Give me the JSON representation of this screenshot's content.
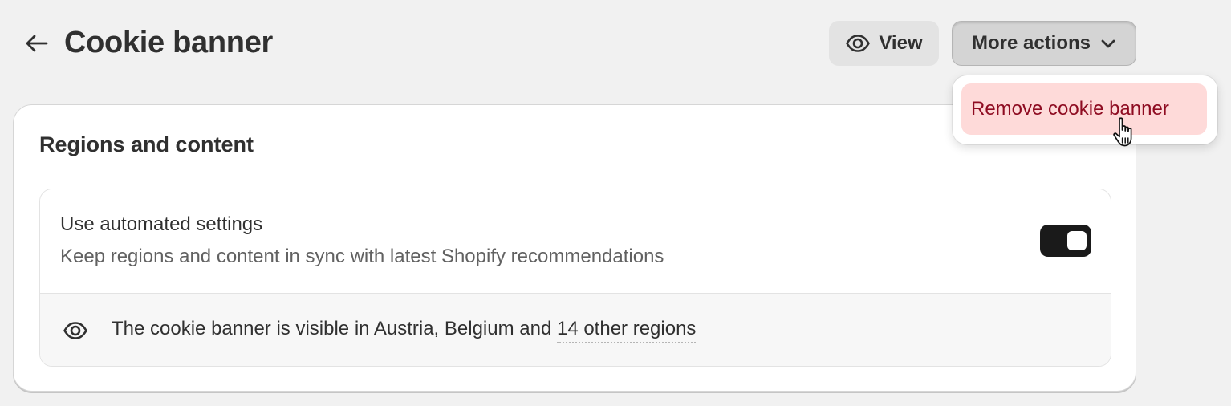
{
  "header": {
    "title": "Cookie banner",
    "view_label": "View",
    "more_actions_label": "More actions"
  },
  "menu": {
    "items": [
      {
        "label": "Remove cookie banner"
      }
    ]
  },
  "card": {
    "title": "Regions and content",
    "automated": {
      "title": "Use automated settings",
      "description": "Keep regions and content in sync with latest Shopify recommendations",
      "enabled": true
    },
    "visibility": {
      "text_prefix": "The cookie banner is visible in Austria, Belgium and ",
      "regions_link": "14 other regions"
    }
  },
  "colors": {
    "background": "#f1f1f1",
    "toggle_on": "#1a1a1a",
    "critical_text": "#8e0b21",
    "critical_bg": "#fedad9"
  },
  "icons": {
    "back": "arrow-left-icon",
    "view": "eye-icon",
    "more": "chevron-down-icon",
    "visibility": "eye-icon",
    "cursor": "hand-pointer-icon"
  }
}
